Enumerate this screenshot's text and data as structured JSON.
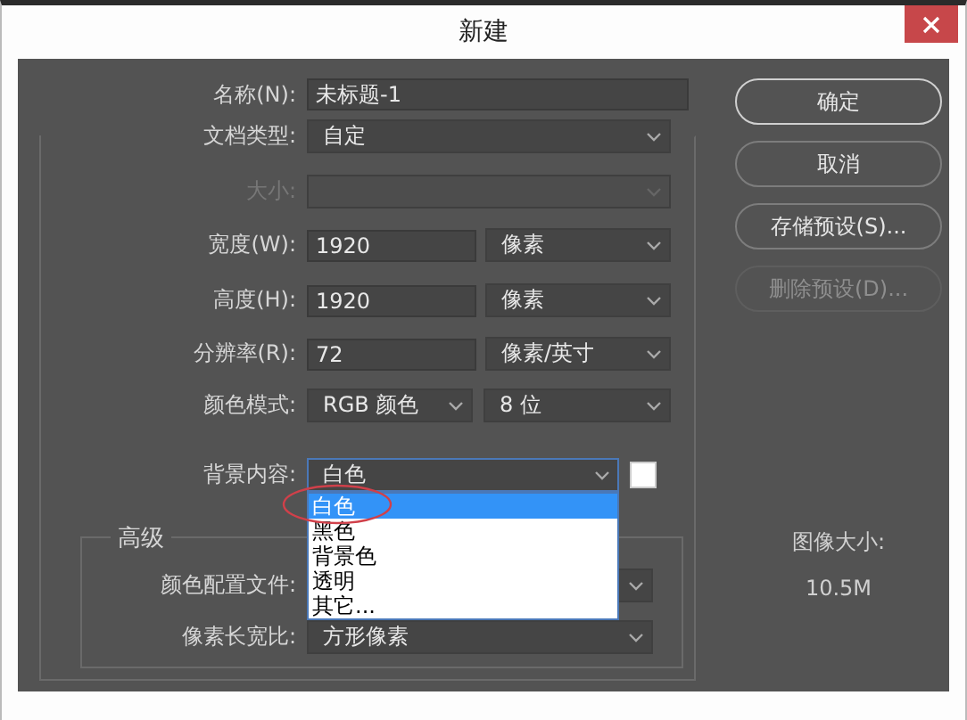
{
  "window": {
    "title": "新建"
  },
  "name": {
    "label": "名称(N):",
    "value": "未标题-1"
  },
  "document_type": {
    "label": "文档类型:",
    "value": "自定"
  },
  "size": {
    "label": "大小:",
    "disabled": true
  },
  "fields": [
    {
      "label": "宽度(W):",
      "value": "1920",
      "unit": "像素"
    },
    {
      "label": "高度(H):",
      "value": "1920",
      "unit": "像素"
    },
    {
      "label": "分辨率(R):",
      "value": "72",
      "unit": "像素/英寸"
    }
  ],
  "color_mode": {
    "label": "颜色模式:",
    "mode": "RGB 颜色",
    "depth": "8 位"
  },
  "background": {
    "label": "背景内容:",
    "value": "白色",
    "expanded": true,
    "options": [
      {
        "label": "白色",
        "selected": true
      },
      {
        "label": "黑色",
        "selected": false
      },
      {
        "label": "背景色",
        "selected": false
      },
      {
        "label": "透明",
        "selected": false
      },
      {
        "label": "其它...",
        "selected": false
      }
    ]
  },
  "advanced": {
    "title": "高级",
    "rows": [
      {
        "label": "颜色配置文件:"
      },
      {
        "label": "像素长宽比:",
        "value": "方形像素"
      }
    ]
  },
  "buttons": [
    {
      "label": "确定",
      "default": true,
      "disabled": false
    },
    {
      "label": "取消",
      "default": false,
      "disabled": false
    },
    {
      "label": "存储预设(S)...",
      "default": false,
      "disabled": false
    },
    {
      "label": "删除预设(D)...",
      "default": false,
      "disabled": true
    }
  ],
  "image_size": {
    "label": "图像大小:",
    "value": "10.5M"
  }
}
